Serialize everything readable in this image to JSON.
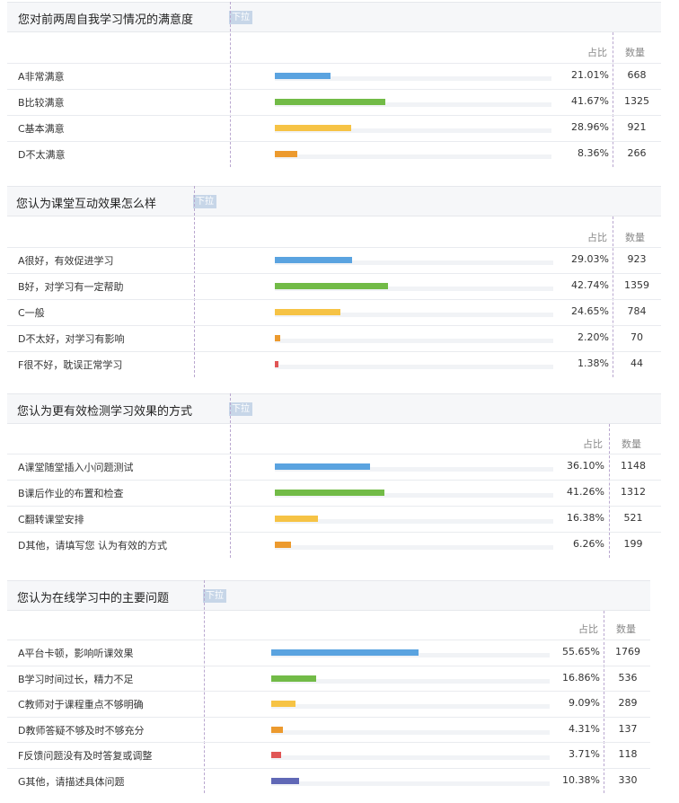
{
  "pct_header": "占比",
  "count_header": "数量",
  "drop_btn": "下拉",
  "colors": [
    "#5aa3e0",
    "#72bb47",
    "#f6c345",
    "#ec9a2e",
    "#e05555",
    "#6068b6"
  ],
  "questions": [
    {
      "title": "您对前两周自我学习情况的满意度",
      "options": [
        {
          "label": "A非常满意",
          "pct": "21.01%",
          "value": 21.01,
          "count": "668"
        },
        {
          "label": "B比较满意",
          "pct": "41.67%",
          "value": 41.67,
          "count": "1325"
        },
        {
          "label": "C基本满意",
          "pct": "28.96%",
          "value": 28.96,
          "count": "921"
        },
        {
          "label": "D不太满意",
          "pct": "8.36%",
          "value": 8.36,
          "count": "266"
        }
      ]
    },
    {
      "title": "您认为课堂互动效果怎么样",
      "options": [
        {
          "label": "A很好，有效促进学习",
          "pct": "29.03%",
          "value": 29.03,
          "count": "923"
        },
        {
          "label": "B好，对学习有一定帮助",
          "pct": "42.74%",
          "value": 42.74,
          "count": "1359"
        },
        {
          "label": "C一般",
          "pct": "24.65%",
          "value": 24.65,
          "count": "784"
        },
        {
          "label": "D不太好，对学习有影响",
          "pct": "2.20%",
          "value": 2.2,
          "count": "70"
        },
        {
          "label": "F很不好，耽误正常学习",
          "pct": "1.38%",
          "value": 1.38,
          "count": "44"
        }
      ]
    },
    {
      "title": "您认为更有效检测学习效果的方式",
      "options": [
        {
          "label": "A课堂随堂插入小问题测试",
          "pct": "36.10%",
          "value": 36.1,
          "count": "1148"
        },
        {
          "label": "B课后作业的布置和检查",
          "pct": "41.26%",
          "value": 41.26,
          "count": "1312"
        },
        {
          "label": "C翻转课堂安排",
          "pct": "16.38%",
          "value": 16.38,
          "count": "521"
        },
        {
          "label": "D其他，请填写您 认为有效的方式",
          "pct": "6.26%",
          "value": 6.26,
          "count": "199"
        }
      ]
    },
    {
      "title": "您认为在线学习中的主要问题",
      "options": [
        {
          "label": "A平台卡顿，影响听课效果",
          "pct": "55.65%",
          "value": 55.65,
          "count": "1769"
        },
        {
          "label": "B学习时间过长，精力不足",
          "pct": "16.86%",
          "value": 16.86,
          "count": "536"
        },
        {
          "label": "C教师对于课程重点不够明确",
          "pct": "9.09%",
          "value": 9.09,
          "count": "289"
        },
        {
          "label": "D教师答疑不够及时不够充分",
          "pct": "4.31%",
          "value": 4.31,
          "count": "137"
        },
        {
          "label": "F反馈问题没有及时答复或调整",
          "pct": "3.71%",
          "value": 3.71,
          "count": "118"
        },
        {
          "label": "G其他，请描述具体问题",
          "pct": "10.38%",
          "value": 10.38,
          "count": "330"
        }
      ]
    }
  ]
}
